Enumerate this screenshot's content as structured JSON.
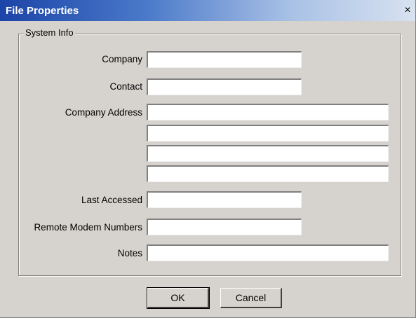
{
  "window": {
    "title": "File Properties",
    "close_glyph": "×"
  },
  "group": {
    "label": "System Info"
  },
  "fields": {
    "company": {
      "label": "Company",
      "value": ""
    },
    "contact": {
      "label": "Contact",
      "value": ""
    },
    "company_address": {
      "label": "Company Address",
      "lines": [
        "",
        "",
        "",
        ""
      ]
    },
    "last_accessed": {
      "label": "Last Accessed",
      "value": ""
    },
    "remote_modem_numbers": {
      "label": "Remote Modem Numbers",
      "value": ""
    },
    "notes": {
      "label": "Notes",
      "value": ""
    }
  },
  "buttons": {
    "ok_label": "OK",
    "cancel_label": "Cancel"
  }
}
